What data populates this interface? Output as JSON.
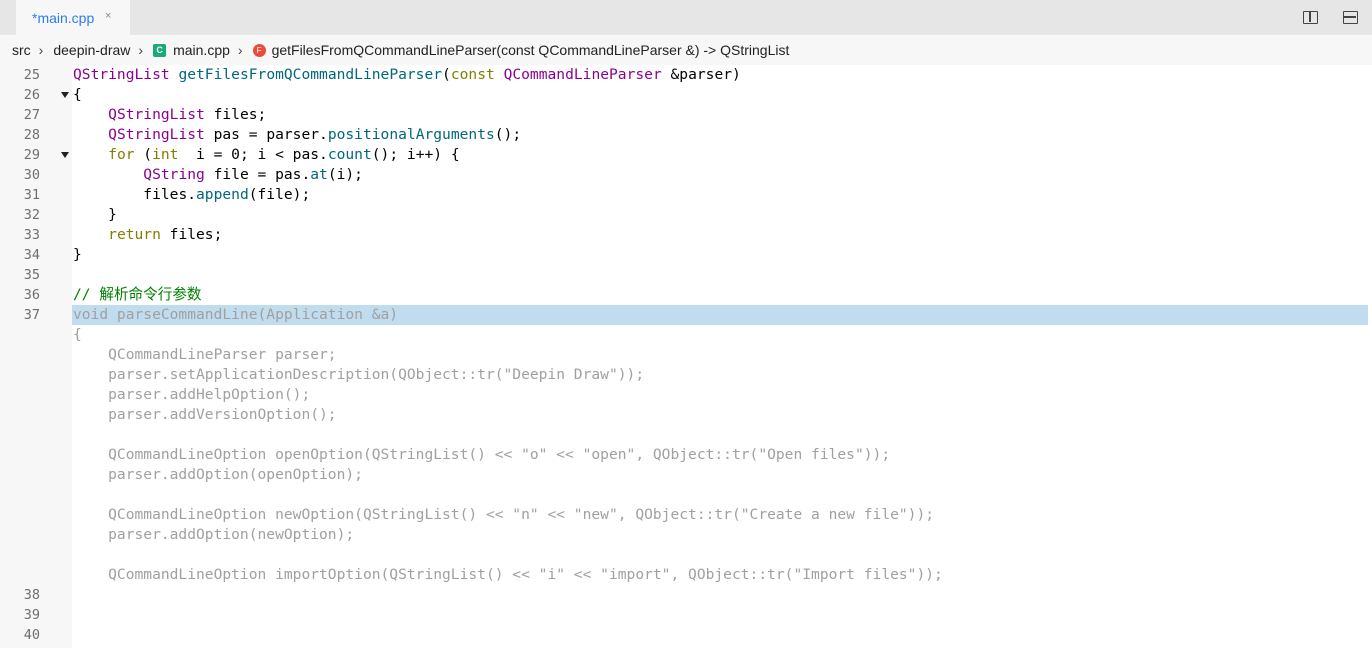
{
  "tab": {
    "label": "*main.cpp",
    "close": "×"
  },
  "breadcrumb": {
    "src": "src",
    "folder": "deepin-draw",
    "file": "main.cpp",
    "file_icon": "C",
    "symbol": "getFilesFromQCommandLineParser(const QCommandLineParser &) -> QStringList",
    "symbol_icon": "F"
  },
  "editor": {
    "line_numbers": [
      "25",
      "26",
      "27",
      "28",
      "29",
      "30",
      "31",
      "32",
      "33",
      "34",
      "35",
      "36",
      "37",
      "38",
      "39",
      "40"
    ],
    "code": {
      "l25": {
        "t": "QStringList",
        "f": "getFilesFromQCommandLineParser",
        "p1": "(",
        "k": "const",
        "t2": "QCommandLineParser",
        "rest": " &parser)"
      },
      "l26": "{",
      "l27": {
        "t": "QStringList",
        "rest": " files;"
      },
      "l28": {
        "t": "QStringList",
        "a": " pas = parser.",
        "f": "positionalArguments",
        "rest": "();"
      },
      "l29": {
        "k": "for",
        "a": " (",
        "k2": "int",
        "b": "  i = 0; i < pas.",
        "f": "count",
        "rest": "(); i++) {"
      },
      "l30": {
        "t": "QString",
        "a": " file = pas.",
        "f": "at",
        "rest": "(i);"
      },
      "l31": {
        "a": "files.",
        "f": "append",
        "rest": "(file);"
      },
      "l32": "}",
      "l33": {
        "k": "return",
        "rest": " files;"
      },
      "l34": "}",
      "l36": "// 解析命令行参数",
      "l37": "void parseCommandLine(Application &a)",
      "ghost": [
        "{",
        "    QCommandLineParser parser;",
        "    parser.setApplicationDescription(QObject::tr(\"Deepin Draw\"));",
        "    parser.addHelpOption();",
        "    parser.addVersionOption();",
        "",
        "    QCommandLineOption openOption(QStringList() << \"o\" << \"open\", QObject::tr(\"Open files\"));",
        "    parser.addOption(openOption);",
        "",
        "    QCommandLineOption newOption(QStringList() << \"n\" << \"new\", QObject::tr(\"Create a new file\"));",
        "    parser.addOption(newOption);",
        "",
        "    QCommandLineOption importOption(QStringList() << \"i\" << \"import\", QObject::tr(\"Import files\"));"
      ]
    }
  }
}
